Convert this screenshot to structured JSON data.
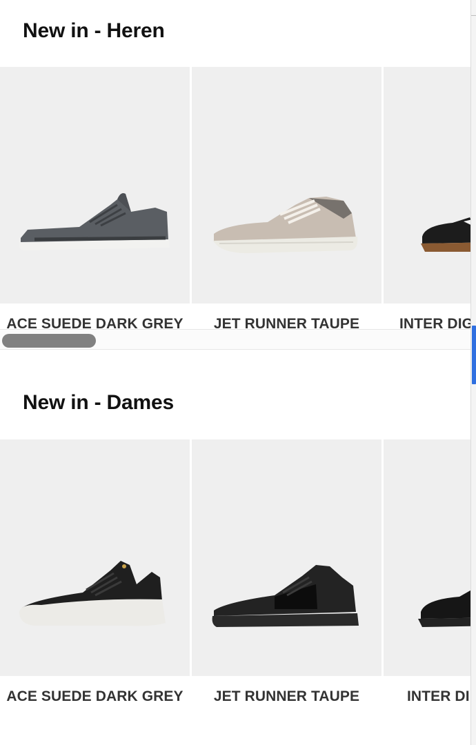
{
  "sections": [
    {
      "title": "New in - Heren",
      "products": [
        {
          "name": "ACE SUEDE DARK GREY",
          "shoe": "grey-suede-low-sneaker"
        },
        {
          "name": "JET RUNNER TAUPE",
          "shoe": "taupe-runner-sneaker"
        },
        {
          "name": "INTER DIG",
          "shoe": "black-white-gum-sneaker"
        }
      ]
    },
    {
      "title": "New in - Dames",
      "products": [
        {
          "name": "ACE SUEDE DARK GREY",
          "shoe": "black-white-sole-sneaker"
        },
        {
          "name": "JET RUNNER TAUPE",
          "shoe": "black-suede-sneaker"
        },
        {
          "name": "INTER DI",
          "shoe": "black-leather-derby"
        }
      ]
    }
  ],
  "colors": {
    "card_bg": "#efefef",
    "title": "#111111",
    "product_name": "#333333",
    "scroll_thumb": "#2f6fe0"
  }
}
